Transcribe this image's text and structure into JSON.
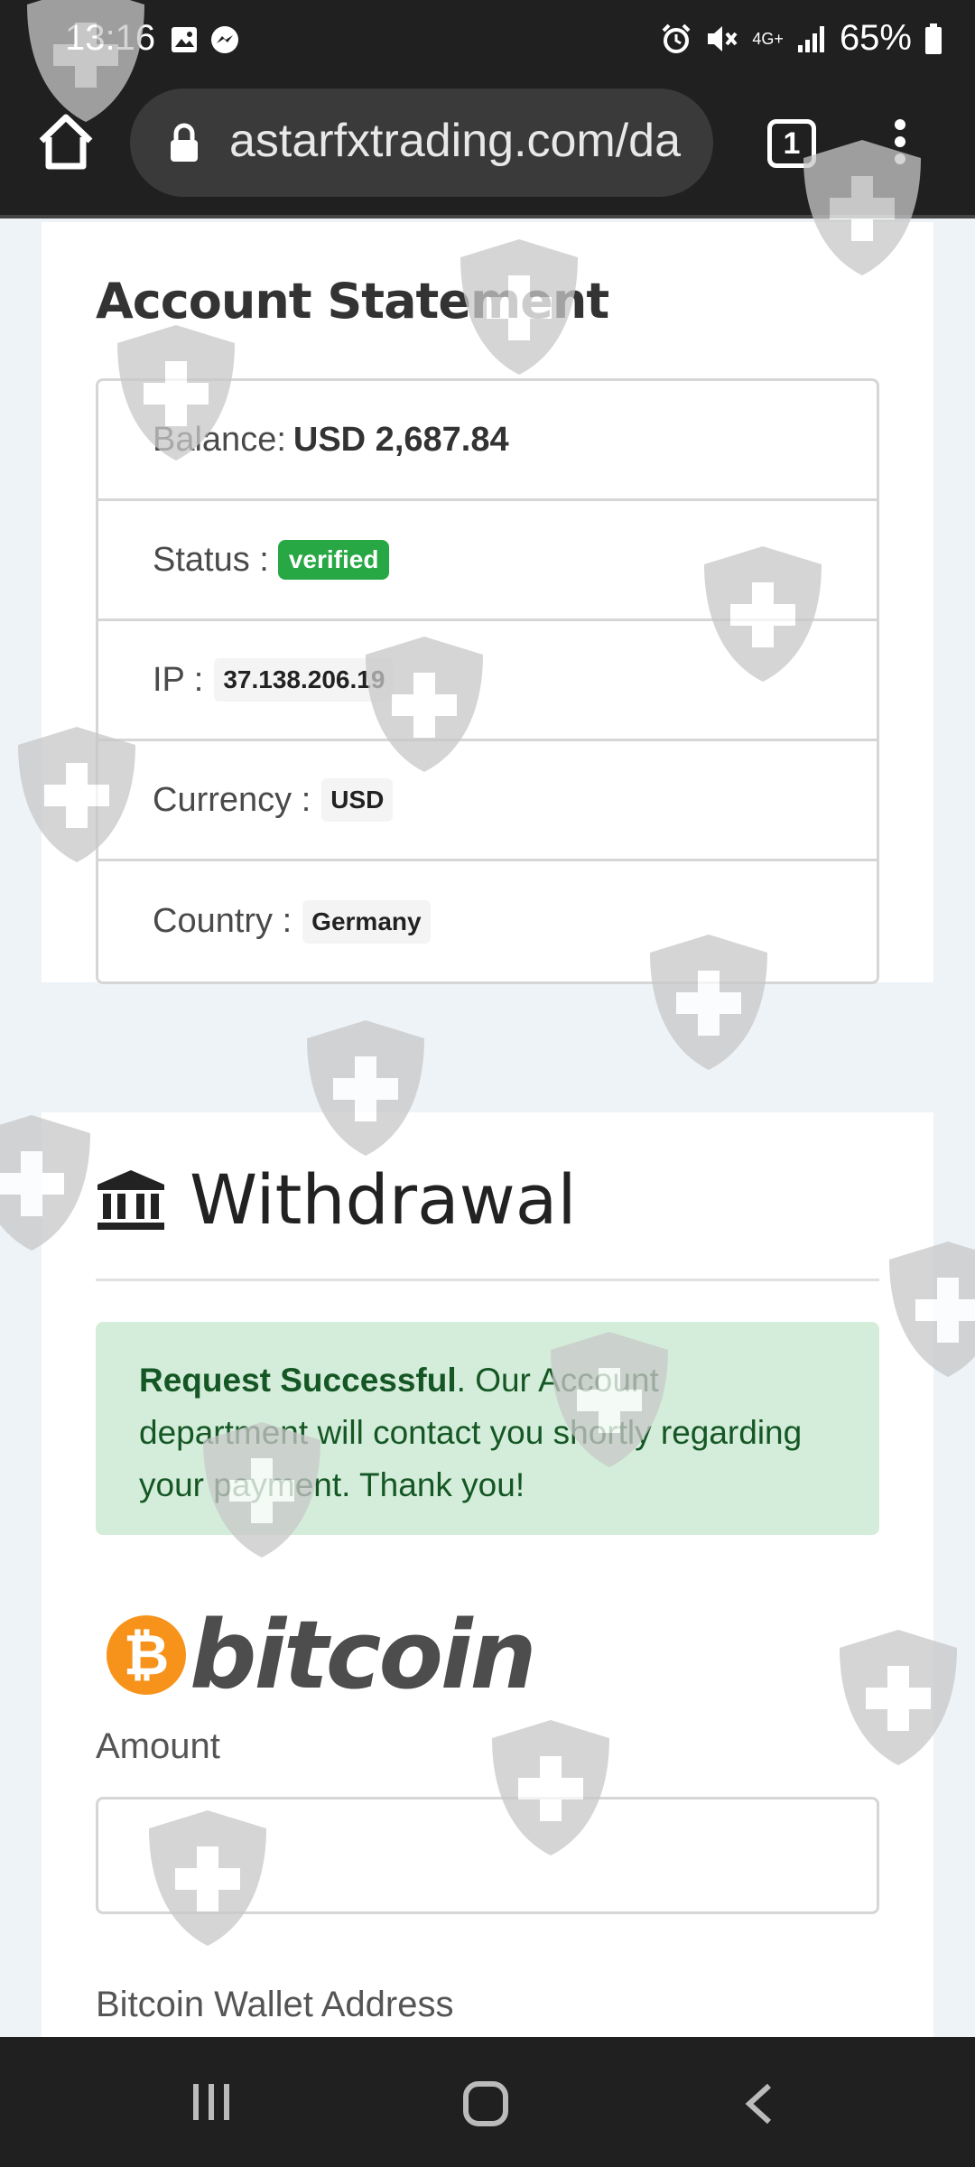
{
  "status_bar": {
    "time": "13:16",
    "network": "4G+",
    "battery": "65%"
  },
  "browser": {
    "url": "astarfxtrading.com/da",
    "tab_count": "1"
  },
  "statement": {
    "title": "Account Statement",
    "balance_label": "Balance:",
    "balance_value": "USD 2,687.84",
    "status_label": "Status :",
    "status_value": "verified",
    "ip_label": "IP :",
    "ip_value": "37.138.206.19",
    "currency_label": "Currency :",
    "currency_value": "USD",
    "country_label": "Country :",
    "country_value": "Germany"
  },
  "withdrawal": {
    "title": "Withdrawal",
    "alert_strong": "Request Successful",
    "alert_text": ". Our Account department will contact you shortly regarding your payment. Thank you!",
    "logo_text": "bitcoin",
    "logo_symbol": "₿",
    "amount_label": "Amount",
    "amount_value": "",
    "wallet_label": "Bitcoin Wallet Address"
  },
  "colors": {
    "success_badge": "#28a745",
    "alert_bg": "#d4edda",
    "alert_text": "#155724",
    "bitcoin_orange": "#f7931a",
    "chrome_dark": "#202020"
  },
  "icons": [
    "image-icon",
    "messenger-icon",
    "alarm-icon",
    "mute-icon",
    "signal-icon",
    "battery-icon",
    "home-icon",
    "lock-icon",
    "tabs-icon",
    "more-vert-icon",
    "bank-icon",
    "bitcoin-icon",
    "shield-watermark-icon",
    "recents-icon",
    "home-nav-icon",
    "back-icon"
  ]
}
